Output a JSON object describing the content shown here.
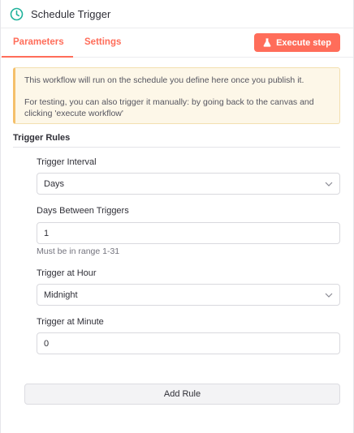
{
  "header": {
    "title": "Schedule Trigger",
    "icon": "clock-icon",
    "icon_color": "#1fb29b"
  },
  "tabs": [
    {
      "label": "Parameters",
      "active": true
    },
    {
      "label": "Settings",
      "active": false
    }
  ],
  "execute_button": {
    "label": "Execute step",
    "icon": "flask-icon",
    "color": "#ff6d5a"
  },
  "notice": {
    "line1": "This workflow will run on the schedule you define here once you publish it.",
    "line2": "For testing, you can also trigger it manually: by going back to the canvas and clicking 'execute workflow'"
  },
  "trigger_rules": {
    "title": "Trigger Rules",
    "interval": {
      "label": "Trigger Interval",
      "value": "Days"
    },
    "days_between": {
      "label": "Days Between Triggers",
      "value": "1",
      "hint": "Must be in range 1-31"
    },
    "hour": {
      "label": "Trigger at Hour",
      "value": "Midnight"
    },
    "minute": {
      "label": "Trigger at Minute",
      "value": "0"
    },
    "add_rule_label": "Add Rule"
  }
}
